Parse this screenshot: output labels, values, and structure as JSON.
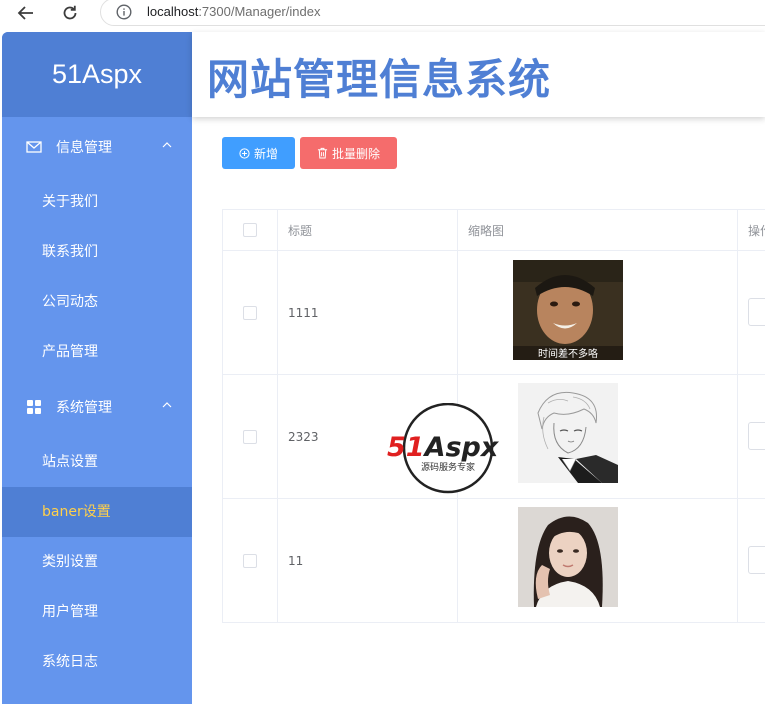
{
  "browser": {
    "url_host": "localhost",
    "url_rest": ":7300/Manager/index"
  },
  "sidebar": {
    "logo": "51Aspx",
    "groups": [
      {
        "label": "信息管理",
        "icon": "envelope-icon",
        "items": [
          "关于我们",
          "联系我们",
          "公司动态",
          "产品管理"
        ]
      },
      {
        "label": "系统管理",
        "icon": "grid-icon",
        "items": [
          "站点设置",
          "baner设置",
          "类别设置",
          "用户管理",
          "系统日志"
        ]
      }
    ],
    "active_item": "baner设置"
  },
  "header": {
    "title": "网站管理信息系统"
  },
  "toolbar": {
    "add_label": "新增",
    "batch_delete_label": "批量删除"
  },
  "table": {
    "columns": [
      "标题",
      "缩略图",
      "操作"
    ],
    "rows": [
      {
        "title": "1111",
        "thumb_caption": "时间差不多咯"
      },
      {
        "title": "2323"
      },
      {
        "title": "11"
      }
    ]
  },
  "watermark": {
    "brand": "51Aspx",
    "tagline": "源码服务专家"
  },
  "colors": {
    "sidebar": "#6495ed",
    "sidebar_dark": "#4f7fd4",
    "active_text": "#ffd04b",
    "primary": "#409eff",
    "danger": "#f56c6c"
  }
}
